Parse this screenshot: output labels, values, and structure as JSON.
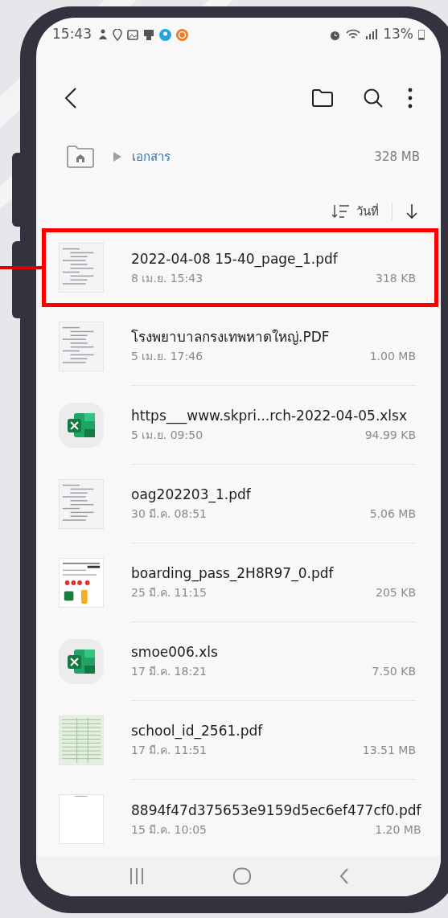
{
  "status_bar": {
    "time": "15:43",
    "battery": "13%"
  },
  "breadcrumb": {
    "folder": "เอกสาร",
    "size": "328 MB"
  },
  "sort": {
    "label": "วันที่"
  },
  "files": [
    {
      "kind": "document",
      "name": "2022-04-08 15-40_page_1.pdf",
      "date": "8 เม.ย. 15:43",
      "size": "318 KB",
      "highlighted": true
    },
    {
      "kind": "document",
      "name": "โรงพยาบาลกรงเทพหาดใหญ่.PDF",
      "date": "5 เม.ย. 17:46",
      "size": "1.00 MB",
      "highlighted": false
    },
    {
      "kind": "excel",
      "name": "https___www.skpri...rch-2022-04-05.xlsx",
      "date": "5 เม.ย. 09:50",
      "size": "94.99 KB",
      "highlighted": false
    },
    {
      "kind": "document",
      "name": "oag202203_1.pdf",
      "date": "30 มี.ค. 08:51",
      "size": "5.06 MB",
      "highlighted": false
    },
    {
      "kind": "ticket",
      "name": "boarding_pass_2H8R97_0.pdf",
      "date": "25 มี.ค. 11:15",
      "size": "205 KB",
      "highlighted": false
    },
    {
      "kind": "excel",
      "name": "smoe006.xls",
      "date": "17 มี.ค. 18:21",
      "size": "7.50 KB",
      "highlighted": false
    },
    {
      "kind": "sheet",
      "name": "school_id_2561.pdf",
      "date": "17 มี.ค. 11:51",
      "size": "13.51 MB",
      "highlighted": false
    },
    {
      "kind": "blank",
      "name": "8894f47d375653e9159d5ec6ef477cf0.pdf",
      "date": "15 มี.ค. 10:05",
      "size": "1.20 MB",
      "highlighted": false
    }
  ]
}
